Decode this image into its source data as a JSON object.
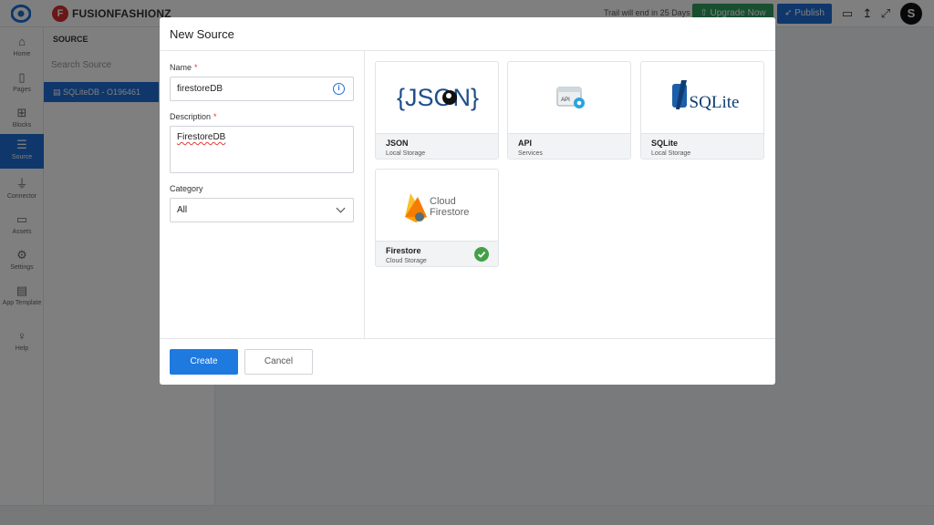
{
  "app": {
    "brand_initial": "F",
    "brand_name": "FUSIONFASHIONZ",
    "trial_text": "Trail will end in 25 Days",
    "upgrade_label": "Upgrade Now",
    "publish_label": "Publish",
    "user_initial": "S"
  },
  "nav": [
    {
      "label": "Home",
      "icon": "home-icon"
    },
    {
      "label": "Pages",
      "icon": "page-icon"
    },
    {
      "label": "Blocks",
      "icon": "blocks-icon"
    },
    {
      "label": "Source",
      "icon": "database-icon"
    },
    {
      "label": "Connector",
      "icon": "plug-icon"
    },
    {
      "label": "Assets",
      "icon": "monitor-icon"
    },
    {
      "label": "Settings",
      "icon": "gear-icon"
    },
    {
      "label": "App Template",
      "icon": "template-icon"
    },
    {
      "label": "Help",
      "icon": "bulb-icon"
    }
  ],
  "source_panel": {
    "heading": "SOURCE",
    "search_placeholder": "Search Source",
    "item": "SQLiteDB - O196461"
  },
  "modal": {
    "title": "New Source",
    "name_label": "Name",
    "name_value": "firestoreDB",
    "description_label": "Description",
    "description_value": "FirestoreDB",
    "category_label": "Category",
    "category_value": "All",
    "required_mark": "*",
    "create_label": "Create",
    "cancel_label": "Cancel",
    "sources": [
      {
        "name": "JSON",
        "sub": "Local Storage",
        "logo": "json-logo",
        "selected": false
      },
      {
        "name": "API",
        "sub": "Services",
        "logo": "api-logo",
        "selected": false
      },
      {
        "name": "SQLite",
        "sub": "Local Storage",
        "logo": "sqlite-logo",
        "selected": false
      },
      {
        "name": "Firestore",
        "sub": "Cloud Storage",
        "logo": "cloud-firestore-logo",
        "selected": true
      }
    ],
    "logo_text": {
      "json": "{JSON}",
      "api": "API",
      "sqlite": "SQLite",
      "cloud": "Cloud",
      "firestore": "Firestore"
    }
  },
  "colors": {
    "primary": "#1f7ae0",
    "upgrade": "#2f9e5f",
    "brand_red": "#d32f2f",
    "selected_check": "#43a047",
    "required": "#e53935"
  }
}
